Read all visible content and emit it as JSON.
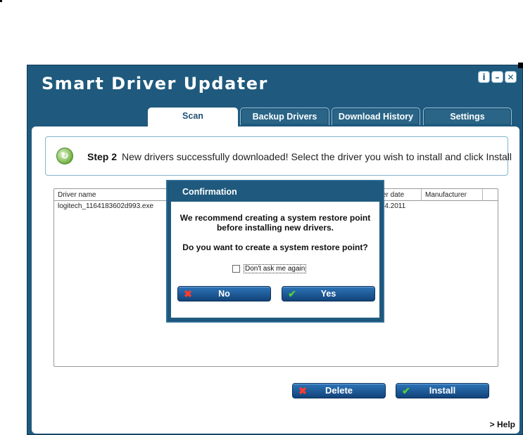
{
  "app": {
    "title": "Smart Driver Updater",
    "window_buttons": [
      {
        "name": "info-button",
        "symbol": "i"
      },
      {
        "name": "minimize-button",
        "symbol": "–"
      },
      {
        "name": "close-button",
        "symbol": "✕"
      }
    ]
  },
  "tabs": [
    {
      "label": "Scan",
      "active": true
    },
    {
      "label": "Backup Drivers",
      "active": false
    },
    {
      "label": "Download History",
      "active": false
    },
    {
      "label": "Settings",
      "active": false
    }
  ],
  "step": {
    "label": "Step 2",
    "text": "New drivers successfully downloaded! Select the driver you wish to install and click Install",
    "icon": "refresh-check-icon"
  },
  "table": {
    "columns": [
      "Driver name",
      "ver date",
      "Manufacturer"
    ],
    "rows": [
      {
        "driver_name": "logitech_1164183602d993.exe",
        "driver_date": ".04.2011",
        "manufacturer": ""
      }
    ]
  },
  "buttons": {
    "delete": "Delete",
    "install": "Install",
    "help": "> Help"
  },
  "dialog": {
    "title": "Confirmation",
    "message_line1": "We recommend creating a system restore point",
    "message_line2": "before installing new drivers.",
    "question": "Do you want to create a system restore point?",
    "checkbox_label": "Don't ask me again",
    "checkbox_checked": false,
    "no_label": "No",
    "yes_label": "Yes"
  },
  "colors": {
    "window": "#1f5a7e",
    "button": "#1d5b9a",
    "cancel_icon": "#ff3b2f",
    "ok_icon": "#4fd03a"
  }
}
